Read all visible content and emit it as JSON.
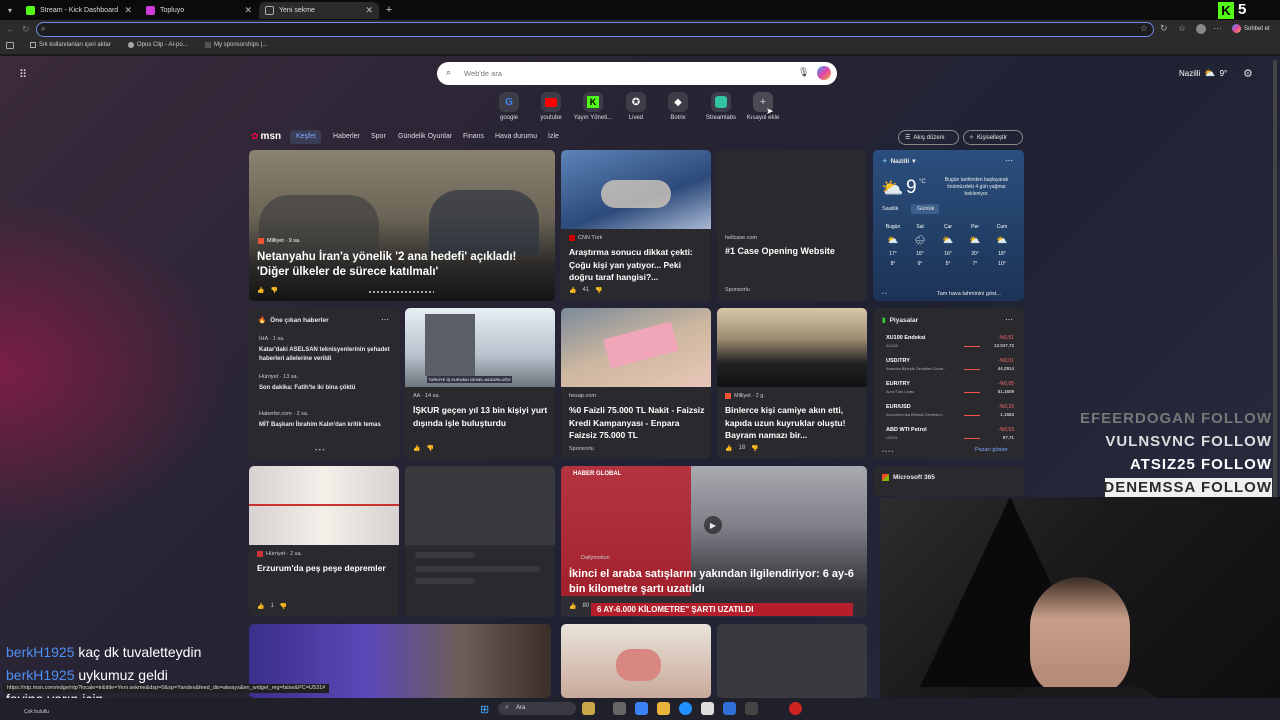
{
  "browser": {
    "tabs": [
      {
        "title": "Stream - Kick Dashboard"
      },
      {
        "title": "Topluyo"
      },
      {
        "title": "Yeni sekme"
      }
    ],
    "right_label": "Sohbet et",
    "bookmarks": [
      "Sık kullanılanları içeri aktar",
      "Opus Clip - AI-po...",
      "My sponsorships |..."
    ],
    "status_url": "https://ntp.msn.com/edge/ntp?locale=tr&title=Yeni sekme&dsp=0&sp=Yandex&feed_dis=always&en_widget_reg=false&PC=U531#"
  },
  "search": {
    "placeholder": "Web'de ara"
  },
  "header_weather": {
    "city": "Nazilli",
    "temp": "9°"
  },
  "shortcuts": [
    {
      "label": "google"
    },
    {
      "label": "youtube"
    },
    {
      "label": "Yayın Yöneti..."
    },
    {
      "label": "Lived"
    },
    {
      "label": "Botrix"
    },
    {
      "label": "Streamlabs"
    },
    {
      "label": "Kısayol ekle"
    }
  ],
  "feed": {
    "logo": "msn",
    "nav": [
      "Keşfet",
      "Haberler",
      "Spor",
      "Gündelik Oyunlar",
      "Finans",
      "Hava durumu",
      "İzle"
    ],
    "feed_layout": "Akış düzeni",
    "personalize": "Kişiselleştir"
  },
  "cards": {
    "hero": {
      "source": "Milliyet · 9 sa.",
      "title": "Netanyahu İran'a yönelik '2 ana hedefi' açıkladı! 'Diğer ülkeler de sürece katılmalı'"
    },
    "cnn": {
      "source": "CNN Türk",
      "title": "Araştırma sonucu dikkat çekti: Çoğu kişi yan yatıyor... Peki doğru taraf hangisi?...",
      "likes": "41"
    },
    "ad1": {
      "source": "hellcase.com",
      "title": "#1 Case Opening Website",
      "tag": "Sponsorlu"
    },
    "top": {
      "header": "Öne çıkan haberler",
      "items": [
        {
          "src": "İHA · 1 sa.",
          "text": "Katar'daki ASELSAN teknisyenlerinin şehadet haberleri ailelerine verildi"
        },
        {
          "src": "Hürriyet · 13 sa.",
          "text": "Son dakika: Fatih'te iki bina çöktü"
        },
        {
          "src": "Haberler.com · 2 sa.",
          "text": "MİT Başkanı İbrahim Kalın'dan kritik temas"
        }
      ]
    },
    "iskur": {
      "source": "AA · 14 sa.",
      "title": "İŞKUR geçen yıl 13 bin kişiyi yurt dışında işle buluşturdu",
      "img": "TÜRKİYE İŞ KURUMU GENEL MÜDÜRLÜĞÜ"
    },
    "ad2": {
      "source": "hesap.com",
      "title": "%0 Faizli 75.000 TL Nakit - Faizsiz Kredi Kampanyası - Enpara Faizsiz 75.000 TL",
      "tag": "Sponsorlu"
    },
    "mosque": {
      "source": "Milliyet · 2 g.",
      "title": "Binlerce kişi camiye akın etti, kapıda uzun kuyruklar oluştu! Bayram namazı bir...",
      "likes": "18"
    },
    "quake": {
      "source": "Hürriyet · 2 sa.",
      "title": "Erzurum'da peş peşe depremler",
      "likes": "1"
    },
    "video": {
      "source": "Dailymotion",
      "title": "İkinci el araba satışlarını yakından ilgilendiriyor: 6 ay-6 bin kilometre şartı uzatıldı",
      "likes": "80",
      "img_top": "HABER GLOBAL",
      "img_bottom": "6 AY-6.000 KİLOMETRE\" ŞARTI UZATILDI"
    }
  },
  "weather": {
    "city": "Nazilli",
    "temp": "9",
    "unit": "°C",
    "note": "Bugün tarihinden başlayarak önümüzdeki 4 gün yağmur bekleniyor.",
    "tabs": [
      "Saatlik",
      "Günlük"
    ],
    "days": [
      {
        "d": "Bugün",
        "h": "17°",
        "l": "8°"
      },
      {
        "d": "Sal",
        "h": "16°",
        "l": "9°"
      },
      {
        "d": "Çar",
        "h": "16°",
        "l": "5°"
      },
      {
        "d": "Per",
        "h": "20°",
        "l": "7°"
      },
      {
        "d": "Cum",
        "h": "18°",
        "l": "10°"
      }
    ],
    "more": "Tam hava tahminini göst..."
  },
  "markets": {
    "title": "Piyasalar",
    "rows": [
      {
        "n": "XU100 Endeksi",
        "d": "XU100",
        "p": "-%0,51",
        "v": "13.047,72"
      },
      {
        "n": "USD/TRY",
        "d": "Amerika Birleşik Devletleri Dolar...",
        "p": "-%0,01",
        "v": "44,2914"
      },
      {
        "n": "EUR/TRY",
        "d": "Avro/Türk Lirası",
        "p": "-%0,05",
        "v": "51,1609"
      },
      {
        "n": "EUR/USD",
        "d": "Avro/Amerika Birleşik Devletleri...",
        "p": "-%0,15",
        "v": "1,1553"
      },
      {
        "n": "ABD WTI Petrol",
        "d": "USOIL",
        "p": "-%0,53",
        "v": "97,71"
      }
    ],
    "more": "Pazarı göster"
  },
  "m365": {
    "title": "Microsoft 365"
  },
  "stream": {
    "follows": [
      {
        "name": "EFEERDOGAN",
        "label": "FOLLOW"
      },
      {
        "name": "VULNSVNC",
        "label": "FOLLOW"
      },
      {
        "name": "ATSIZ25",
        "label": "FOLLOW"
      },
      {
        "name": "DENEMSSA",
        "label": "FOLLOW"
      }
    ],
    "chat": [
      {
        "user": "berkH1925",
        "msg": "kaç dk tuvaletteydin"
      },
      {
        "user": "berkH1925",
        "msg": "uykumuz geldi"
      },
      {
        "user": "favina",
        "msg": "yarın için"
      }
    ],
    "logo_number": "5"
  },
  "taskbar": {
    "search": "Ara",
    "weather": "Çok bulutlu"
  },
  "colors": {
    "accent": "#6b8ee8",
    "kick_green": "#53fc18",
    "chat_user": "#4f8ff4",
    "follow_dim": "#777777"
  }
}
